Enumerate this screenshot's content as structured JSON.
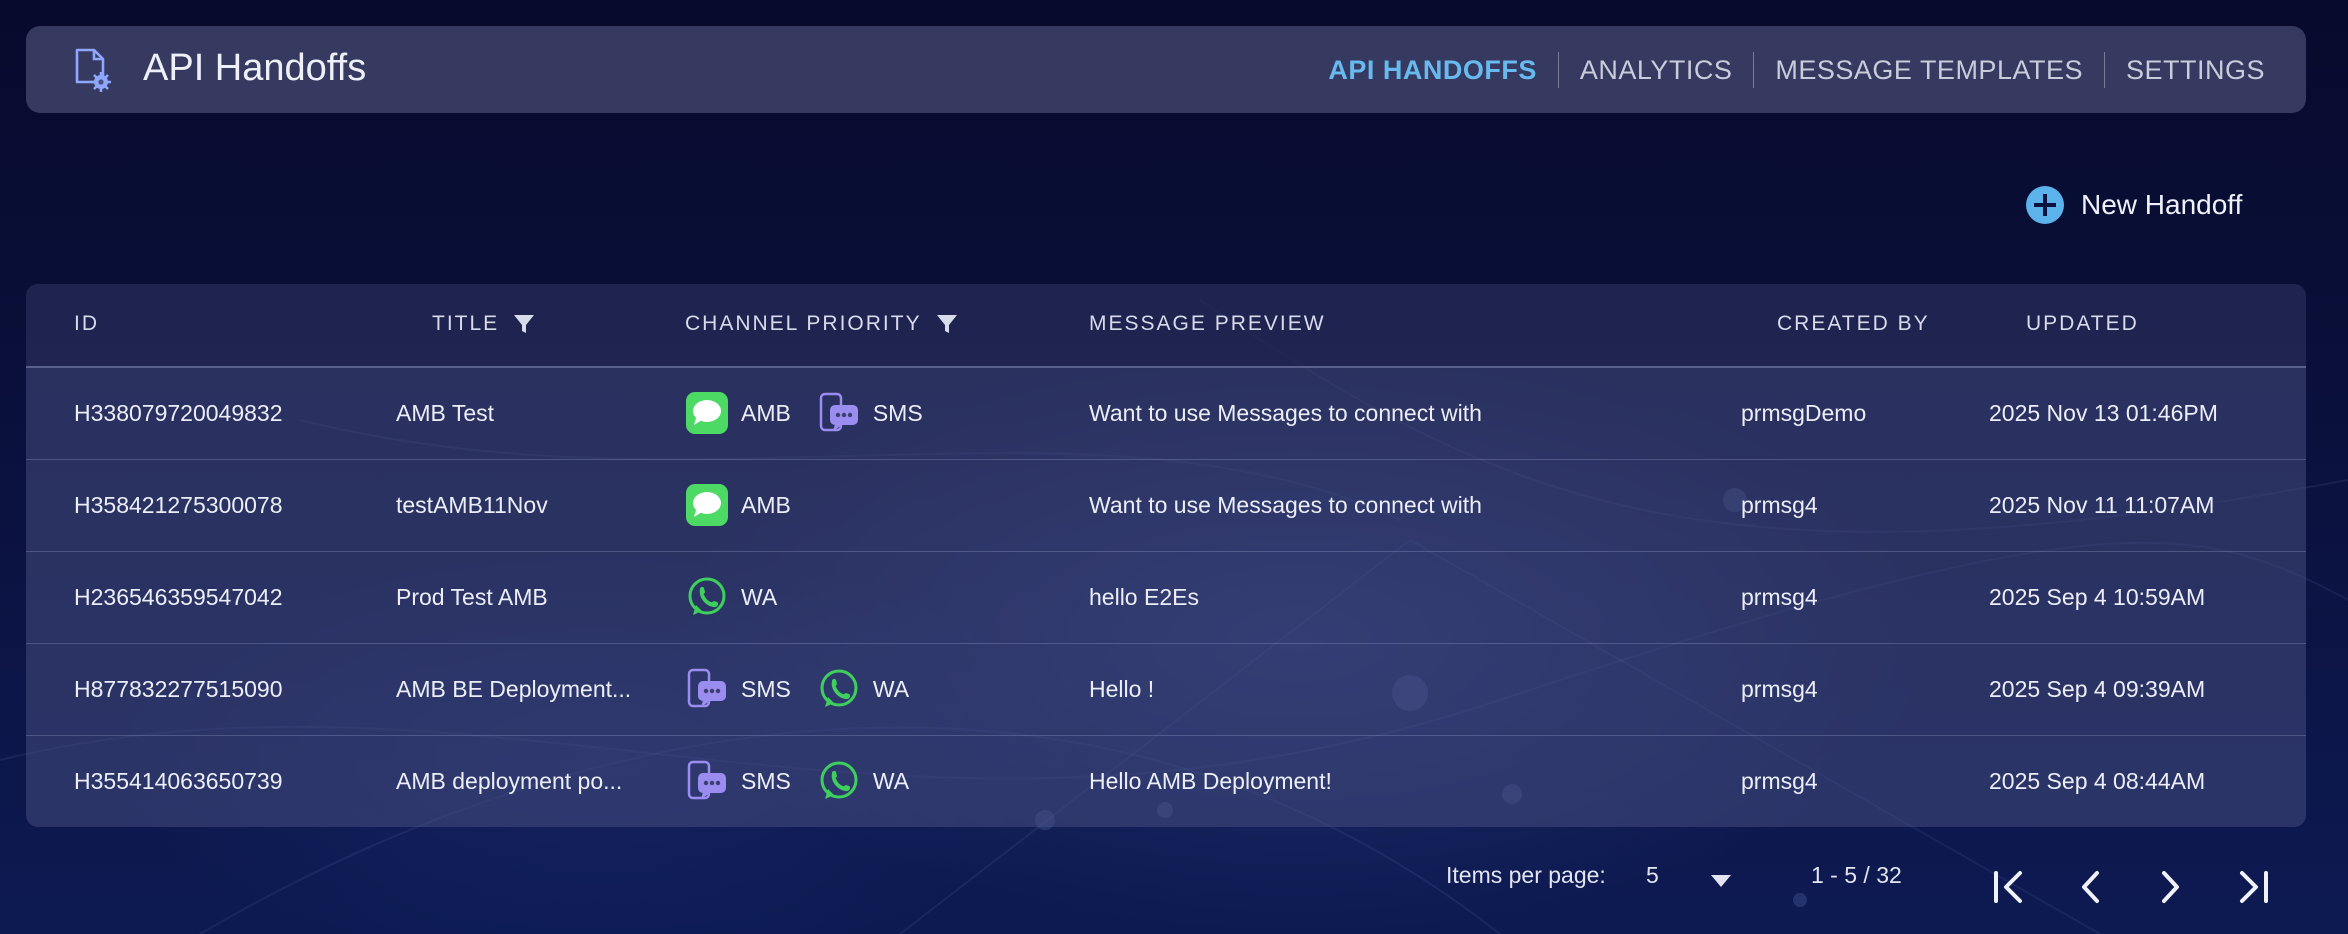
{
  "header": {
    "title": "API Handoffs",
    "app_icon": "document-gear-icon",
    "tabs": [
      {
        "label": "API HANDOFFS",
        "active": true
      },
      {
        "label": "ANALYTICS",
        "active": false
      },
      {
        "label": "MESSAGE TEMPLATES",
        "active": false
      },
      {
        "label": "SETTINGS",
        "active": false
      }
    ]
  },
  "actions": {
    "new_handoff_label": "New Handoff",
    "new_handoff_icon": "plus-circle-icon"
  },
  "table": {
    "columns": [
      "ID",
      "TITLE",
      "CHANNEL PRIORITY",
      "MESSAGE PREVIEW",
      "CREATED BY",
      "UPDATED"
    ],
    "rows": [
      {
        "id": "H338079720049832",
        "title": "AMB Test",
        "channels": [
          "AMB",
          "SMS"
        ],
        "preview": "Want to use Messages to connect with",
        "created_by": "prmsgDemo",
        "updated": "2025 Nov 13 01:46PM"
      },
      {
        "id": "H358421275300078",
        "title": "testAMB11Nov",
        "channels": [
          "AMB"
        ],
        "preview": "Want to use Messages to connect with",
        "created_by": "prmsg4",
        "updated": "2025 Nov 11 11:07AM"
      },
      {
        "id": "H236546359547042",
        "title": "Prod Test AMB",
        "channels": [
          "WA"
        ],
        "preview": "hello E2Es",
        "created_by": "prmsg4",
        "updated": "2025 Sep 4 10:59AM"
      },
      {
        "id": "H877832277515090",
        "title": "AMB BE Deployment...",
        "channels": [
          "SMS",
          "WA"
        ],
        "preview": "Hello !",
        "created_by": "prmsg4",
        "updated": "2025 Sep 4 09:39AM"
      },
      {
        "id": "H355414063650739",
        "title": "AMB deployment po...",
        "channels": [
          "SMS",
          "WA"
        ],
        "preview": "Hello AMB Deployment!",
        "created_by": "prmsg4",
        "updated": "2025 Sep 4 08:44AM"
      }
    ]
  },
  "pagination": {
    "items_per_page_label": "Items per page:",
    "items_per_page_value": "5",
    "range": "1 - 5 / 32"
  },
  "colors": {
    "accent": "#67b9ee",
    "amb_green": "#4cd964",
    "sms_purple": "#9b8cf0",
    "wa_green": "#3ecf5c"
  }
}
